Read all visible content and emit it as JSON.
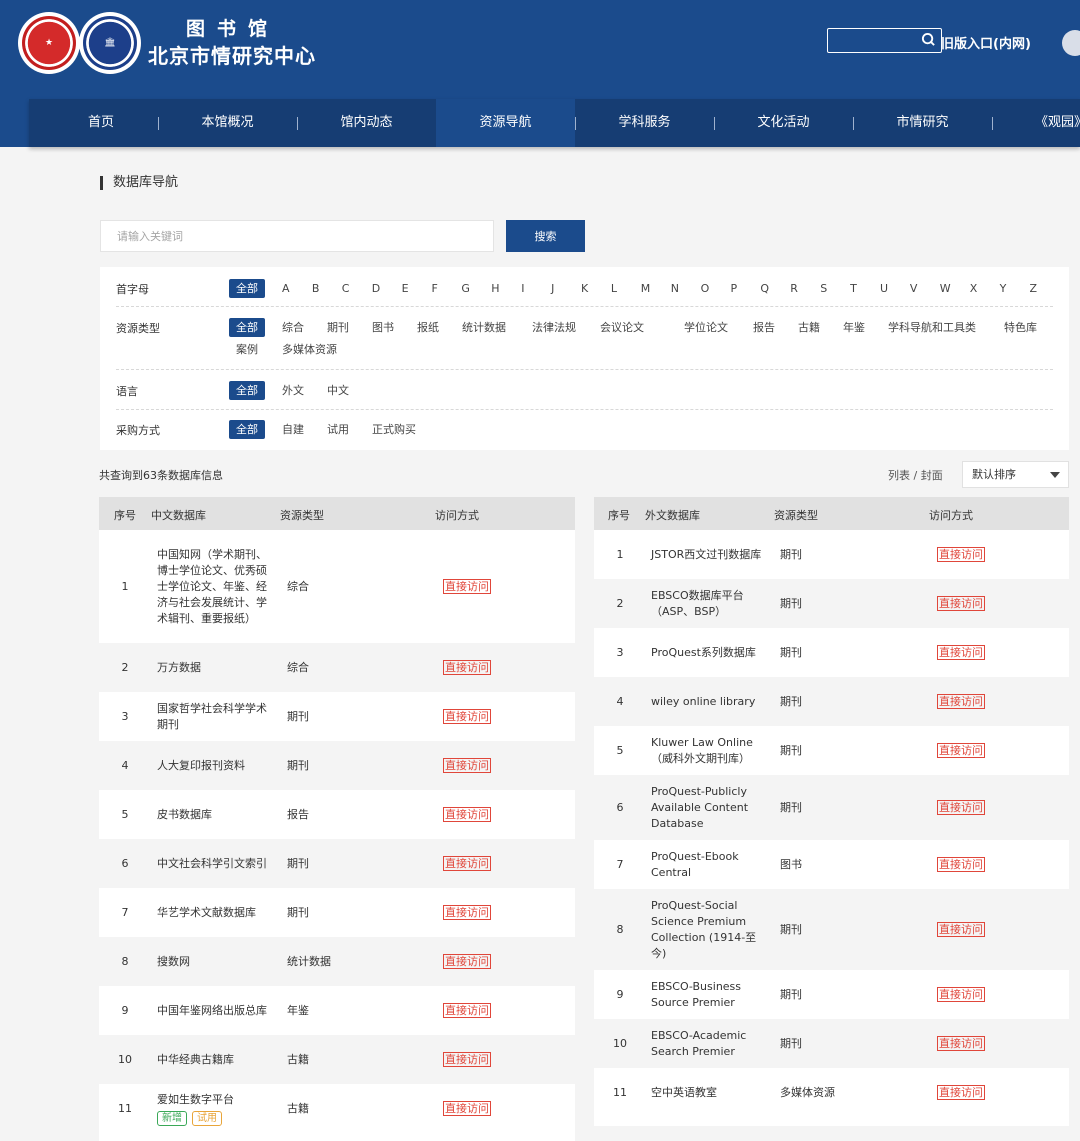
{
  "header": {
    "logo1_icon": "party-school-seal-icon",
    "logo2_icon": "administration-institute-seal-icon",
    "title_top": "图书馆",
    "title_bottom": "北京市情研究中心",
    "search_placeholder": "",
    "old_entry": "旧版入口(内网)"
  },
  "nav": {
    "items": [
      "首页",
      "本馆概况",
      "馆内动态",
      "资源导航",
      "学科服务",
      "文化活动",
      "市情研究",
      "《观园》"
    ],
    "active_index": 3
  },
  "section": {
    "title": "数据库导航"
  },
  "search": {
    "placeholder": "请输入关键词",
    "button": "搜索"
  },
  "filters": {
    "letter": {
      "label": "首字母",
      "all": "全部",
      "options": [
        "A",
        "B",
        "C",
        "D",
        "E",
        "F",
        "G",
        "H",
        "I",
        "J",
        "K",
        "L",
        "M",
        "N",
        "O",
        "P",
        "Q",
        "R",
        "S",
        "T",
        "U",
        "V",
        "W",
        "X",
        "Y",
        "Z"
      ]
    },
    "type": {
      "label": "资源类型",
      "all": "全部",
      "options": [
        "综合",
        "期刊",
        "图书",
        "报纸",
        "统计数据",
        "法律法规",
        "会议论文",
        "学位论文",
        "报告",
        "古籍",
        "年鉴",
        "学科导航和工具类",
        "特色库",
        "案例",
        "多媒体资源"
      ]
    },
    "language": {
      "label": "语言",
      "all": "全部",
      "options": [
        "外文",
        "中文"
      ]
    },
    "purchase": {
      "label": "采购方式",
      "all": "全部",
      "options": [
        "自建",
        "试用",
        "正式购买"
      ]
    }
  },
  "results": {
    "count_text": "共查询到63条数据库信息",
    "view_toggle": "列表 / 封面",
    "sort": "默认排序"
  },
  "left_table": {
    "headers": [
      "序号",
      "中文数据库",
      "资源类型",
      "访问方式"
    ],
    "rows": [
      {
        "num": "1",
        "name": "中国知网（学术期刊、博士学位论文、优秀硕士学位论文、年鉴、经济与社会发展统计、学术辑刊、重要报纸）",
        "type": "综合",
        "access": "直接访问"
      },
      {
        "num": "2",
        "name": "万方数据",
        "type": "综合",
        "access": "直接访问"
      },
      {
        "num": "3",
        "name": "国家哲学社会科学学术期刊",
        "type": "期刊",
        "access": "直接访问"
      },
      {
        "num": "4",
        "name": "人大复印报刊资料",
        "type": "期刊",
        "access": "直接访问"
      },
      {
        "num": "5",
        "name": "皮书数据库",
        "type": "报告",
        "access": "直接访问"
      },
      {
        "num": "6",
        "name": "中文社会科学引文索引",
        "type": "期刊",
        "access": "直接访问"
      },
      {
        "num": "7",
        "name": "华艺学术文献数据库",
        "type": "期刊",
        "access": "直接访问"
      },
      {
        "num": "8",
        "name": "搜数网",
        "type": "统计数据",
        "access": "直接访问"
      },
      {
        "num": "9",
        "name": "中国年鉴网络出版总库",
        "type": "年鉴",
        "access": "直接访问"
      },
      {
        "num": "10",
        "name": "中华经典古籍库",
        "type": "古籍",
        "access": "直接访问"
      },
      {
        "num": "11",
        "name": "爱如生数字平台",
        "type": "古籍",
        "access": "直接访问",
        "tags": [
          "新增",
          "试用"
        ]
      }
    ]
  },
  "right_table": {
    "headers": [
      "序号",
      "外文数据库",
      "资源类型",
      "访问方式"
    ],
    "rows": [
      {
        "num": "1",
        "name": "JSTOR西文过刊数据库",
        "type": "期刊",
        "access": "直接访问"
      },
      {
        "num": "2",
        "name": "EBSCO数据库平台（ASP、BSP）",
        "type": "期刊",
        "access": "直接访问"
      },
      {
        "num": "3",
        "name": "ProQuest系列数据库",
        "type": "期刊",
        "access": "直接访问"
      },
      {
        "num": "4",
        "name": "wiley online library",
        "type": "期刊",
        "access": "直接访问"
      },
      {
        "num": "5",
        "name": "Kluwer Law Online（威科外文期刊库）",
        "type": "期刊",
        "access": "直接访问"
      },
      {
        "num": "6",
        "name": "ProQuest-Publicly Available Content Database",
        "type": "期刊",
        "access": "直接访问"
      },
      {
        "num": "7",
        "name": "ProQuest-Ebook Central",
        "type": "图书",
        "access": "直接访问"
      },
      {
        "num": "8",
        "name": "ProQuest-Social Science Premium Collection (1914-至今)",
        "type": "期刊",
        "access": "直接访问"
      },
      {
        "num": "9",
        "name": "EBSCO-Business Source Premier",
        "type": "期刊",
        "access": "直接访问"
      },
      {
        "num": "10",
        "name": "EBSCO-Academic Search Premier",
        "type": "期刊",
        "access": "直接访问"
      },
      {
        "num": "11",
        "name": "空中英语教室",
        "type": "多媒体资源",
        "access": "直接访问"
      }
    ]
  }
}
